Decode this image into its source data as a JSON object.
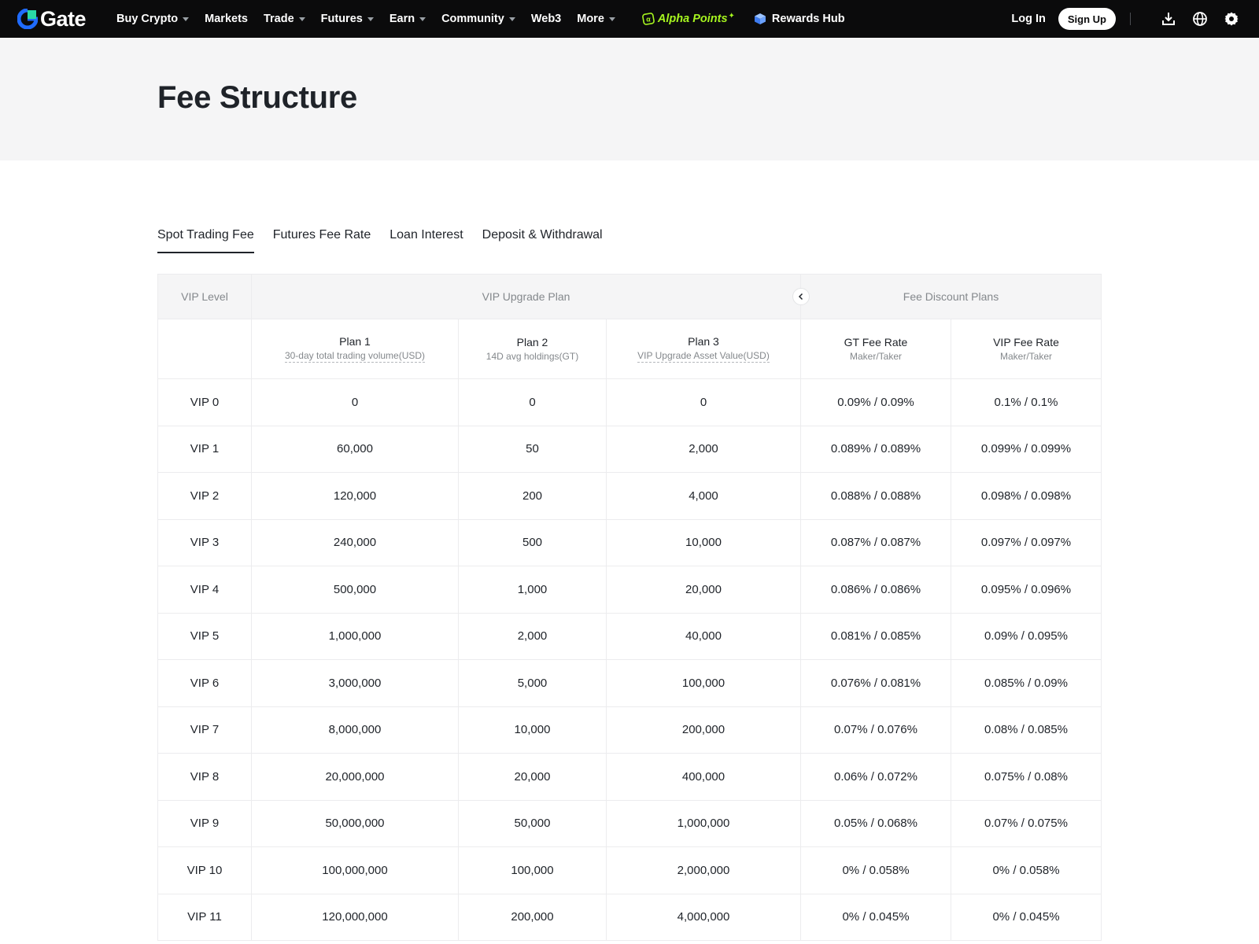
{
  "brand": {
    "name": "Gate",
    "accent": "#1f6bff",
    "alpha_color": "#a6f51f"
  },
  "nav": {
    "items": [
      {
        "label": "Buy Crypto",
        "has_caret": true
      },
      {
        "label": "Markets",
        "has_caret": false
      },
      {
        "label": "Trade",
        "has_caret": true
      },
      {
        "label": "Futures",
        "has_caret": true
      },
      {
        "label": "Earn",
        "has_caret": true
      },
      {
        "label": "Community",
        "has_caret": true
      },
      {
        "label": "Web3",
        "has_caret": false
      },
      {
        "label": "More",
        "has_caret": true
      }
    ],
    "alpha_points": "Alpha Points",
    "rewards_hub": "Rewards Hub",
    "login": "Log In",
    "signup": "Sign Up",
    "icons": [
      "download-icon",
      "globe-icon",
      "gear-icon"
    ]
  },
  "page": {
    "title": "Fee Structure"
  },
  "tabs": [
    {
      "label": "Spot Trading Fee",
      "active": true
    },
    {
      "label": "Futures Fee Rate",
      "active": false
    },
    {
      "label": "Loan Interest",
      "active": false
    },
    {
      "label": "Deposit & Withdrawal",
      "active": false
    }
  ],
  "table": {
    "groups": {
      "level": "VIP Level",
      "upgrade": "VIP Upgrade Plan",
      "discount": "Fee Discount Plans"
    },
    "columns": [
      {
        "title": "",
        "sub": ""
      },
      {
        "title": "Plan 1",
        "sub": "30-day total trading volume(USD)",
        "dotted": true
      },
      {
        "title": "Plan 2",
        "sub": "14D avg holdings(GT)",
        "dotted": false
      },
      {
        "title": "Plan 3",
        "sub": "VIP Upgrade Asset Value(USD)",
        "dotted": true
      },
      {
        "title": "GT Fee Rate",
        "sub": "Maker/Taker",
        "dotted": false
      },
      {
        "title": "VIP Fee Rate",
        "sub": "Maker/Taker",
        "dotted": false
      }
    ],
    "rows": [
      [
        "VIP 0",
        "0",
        "0",
        "0",
        "0.09% / 0.09%",
        "0.1% / 0.1%"
      ],
      [
        "VIP 1",
        "60,000",
        "50",
        "2,000",
        "0.089% / 0.089%",
        "0.099% / 0.099%"
      ],
      [
        "VIP 2",
        "120,000",
        "200",
        "4,000",
        "0.088% / 0.088%",
        "0.098% / 0.098%"
      ],
      [
        "VIP 3",
        "240,000",
        "500",
        "10,000",
        "0.087% / 0.087%",
        "0.097% / 0.097%"
      ],
      [
        "VIP 4",
        "500,000",
        "1,000",
        "20,000",
        "0.086% / 0.086%",
        "0.095% / 0.096%"
      ],
      [
        "VIP 5",
        "1,000,000",
        "2,000",
        "40,000",
        "0.081% / 0.085%",
        "0.09% / 0.095%"
      ],
      [
        "VIP 6",
        "3,000,000",
        "5,000",
        "100,000",
        "0.076% / 0.081%",
        "0.085% / 0.09%"
      ],
      [
        "VIP 7",
        "8,000,000",
        "10,000",
        "200,000",
        "0.07% / 0.076%",
        "0.08% / 0.085%"
      ],
      [
        "VIP 8",
        "20,000,000",
        "20,000",
        "400,000",
        "0.06% / 0.072%",
        "0.075% / 0.08%"
      ],
      [
        "VIP 9",
        "50,000,000",
        "50,000",
        "1,000,000",
        "0.05% / 0.068%",
        "0.07% / 0.075%"
      ],
      [
        "VIP 10",
        "100,000,000",
        "100,000",
        "2,000,000",
        "0% / 0.058%",
        "0% / 0.058%"
      ],
      [
        "VIP 11",
        "120,000,000",
        "200,000",
        "4,000,000",
        "0% / 0.045%",
        "0% / 0.045%"
      ]
    ]
  }
}
